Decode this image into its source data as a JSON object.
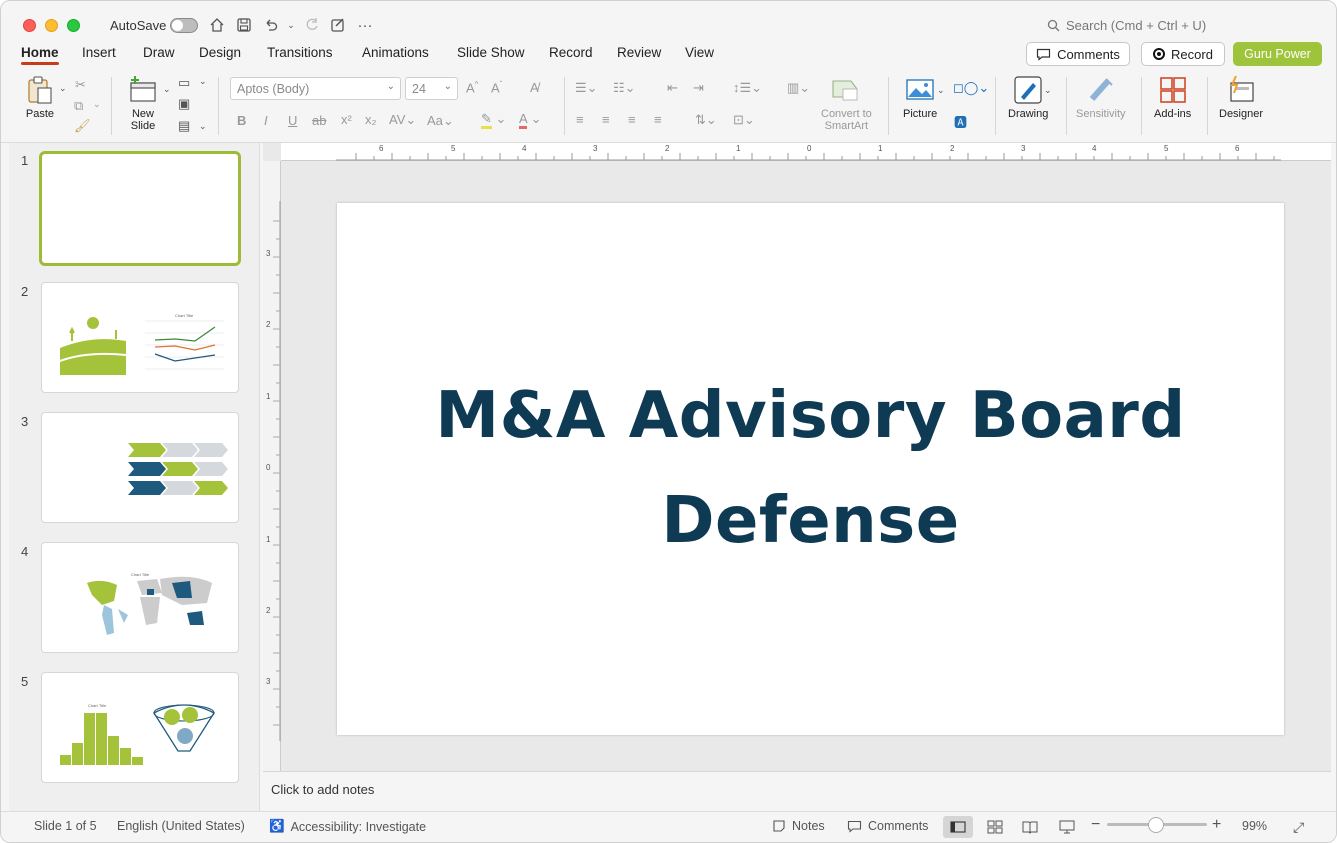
{
  "titlebar": {
    "autosave_label": "AutoSave",
    "search_placeholder": "Search (Cmd + Ctrl + U)"
  },
  "tabs": [
    "Home",
    "Insert",
    "Draw",
    "Design",
    "Transitions",
    "Animations",
    "Slide Show",
    "Record",
    "Review",
    "View"
  ],
  "header_buttons": {
    "comments": "Comments",
    "record": "Record",
    "guru": "Guru Power"
  },
  "ribbon": {
    "paste": "Paste",
    "new_slide_line1": "New",
    "new_slide_line2": "Slide",
    "font": "Aptos (Body)",
    "font_size": "24",
    "convert_line1": "Convert to",
    "convert_line2": "SmartArt",
    "picture": "Picture",
    "drawing": "Drawing",
    "sensitivity": "Sensitivity",
    "addins": "Add-ins",
    "designer": "Designer"
  },
  "thumbnails": [
    {
      "number": "1"
    },
    {
      "number": "2",
      "chart_title": "Chart Title"
    },
    {
      "number": "3"
    },
    {
      "number": "4",
      "chart_title": "Chart Title"
    },
    {
      "number": "5",
      "chart_title": "Chart Title"
    }
  ],
  "ruler": {
    "h_labels": [
      "6",
      "5",
      "4",
      "3",
      "2",
      "1",
      "0",
      "1",
      "2",
      "3",
      "4",
      "5",
      "6"
    ],
    "v_labels": [
      "3",
      "2",
      "1",
      "0",
      "1",
      "2",
      "3"
    ]
  },
  "slide": {
    "title_line1": "M&A Advisory Board",
    "title_line2": "Defense"
  },
  "notes": {
    "placeholder": "Click to add notes"
  },
  "statusbar": {
    "slide_info": "Slide 1 of 5",
    "language": "English (United States)",
    "accessibility": "Accessibility: Investigate",
    "notes": "Notes",
    "comments": "Comments",
    "zoom": "99%"
  },
  "colors": {
    "accent_green": "#9dc43a",
    "title_navy": "#0e3a54",
    "active_tab_underline": "#c43e1c",
    "theme_blue": "#1e5a7e"
  }
}
